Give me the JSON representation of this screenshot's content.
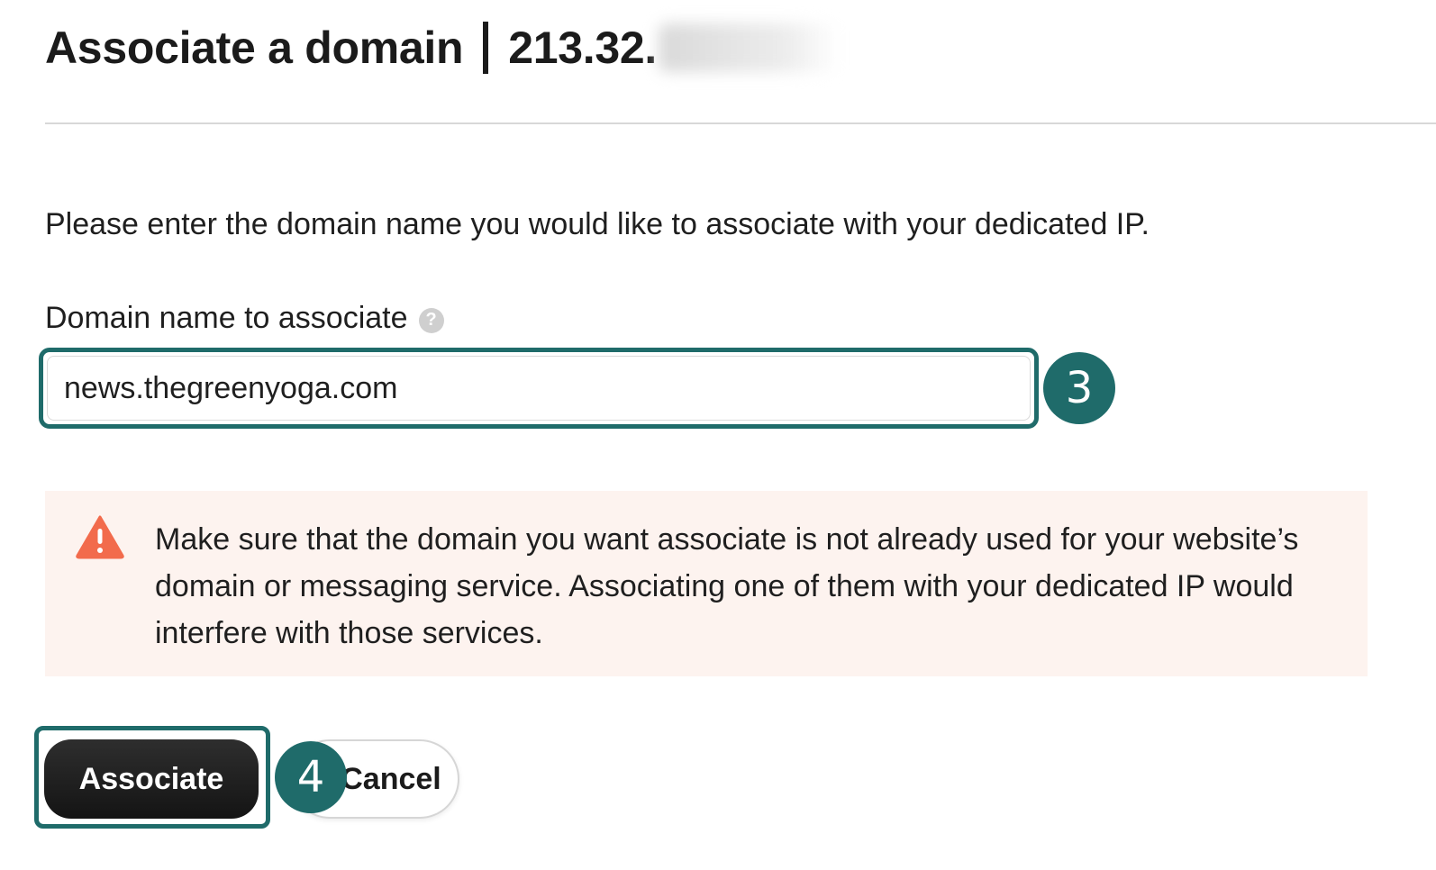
{
  "header": {
    "title": "Associate a domain",
    "ip_visible": "213.32."
  },
  "form": {
    "intro": "Please enter the domain name you would like to associate with your dedicated IP.",
    "domain_label": "Domain name to associate",
    "help_glyph": "?",
    "domain_value": "news.thegreenyoga.com"
  },
  "warning": {
    "icon": "warning-triangle-icon",
    "text": "Make sure that the domain you want associate is not already used for your website’s domain or messaging service. Associating one of them with your dedicated IP would interfere with those services."
  },
  "actions": {
    "associate_label": "Associate",
    "cancel_label": "Cancel"
  },
  "annotations": {
    "step_input": "3",
    "step_button": "4"
  },
  "colors": {
    "accent_teal": "#1f6b6a",
    "warning_bg": "#fdf3ef",
    "warning_icon": "#f26b4c",
    "primary_button": "#1b1b1b"
  }
}
